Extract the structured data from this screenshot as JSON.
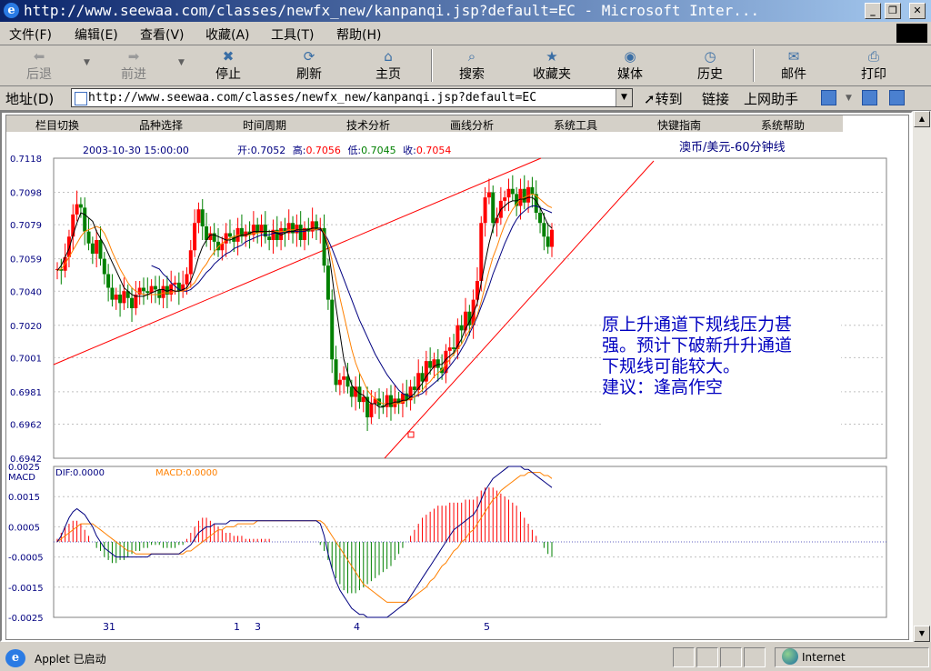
{
  "window": {
    "title": "http://www.seewaa.com/classes/newfx_new/kanpanqi.jsp?default=EC - Microsoft Inter..."
  },
  "menu": [
    "文件(F)",
    "编辑(E)",
    "查看(V)",
    "收藏(A)",
    "工具(T)",
    "帮助(H)"
  ],
  "toolbar": {
    "back": "后退",
    "forward": "前进",
    "stop": "停止",
    "refresh": "刷新",
    "home": "主页",
    "search": "搜索",
    "favorites": "收藏夹",
    "media": "媒体",
    "history": "历史",
    "mail": "邮件",
    "print": "打印"
  },
  "address": {
    "label": "地址(D)",
    "url": "http://www.seewaa.com/classes/newfx_new/kanpanqi.jsp?default=EC",
    "go": "转到",
    "links": "链接",
    "helper": "上网助手"
  },
  "applet_nav": [
    "栏目切换",
    "品种选择",
    "时间周期",
    "技术分析",
    "画线分析",
    "系统工具",
    "快键指南",
    "系统帮助"
  ],
  "chart": {
    "title": "澳币/美元-60分钟线",
    "datetime": "2003-10-30 15:00:00",
    "ohlc": {
      "open_label": "开:",
      "open": "0.7052",
      "high_label": "高:",
      "high": "0.7056",
      "low_label": "低:",
      "low": "0.7045",
      "close_label": "收:",
      "close": "0.7054"
    },
    "annotation": [
      "原上升通道下规线压力甚",
      "强。预计下破新升升通道",
      "下规线可能较大。",
      "建议：逢高作空"
    ],
    "macd_label": "MACD",
    "dif_label": "DIF:0.0000",
    "macd_value_label": "MACD:0.0000",
    "date_labels": [
      "31",
      "1",
      "3",
      "4",
      "5"
    ],
    "colors": {
      "up": "#ff0000",
      "down": "#008000",
      "ma_short": "#000000",
      "ma_mid": "#ff8000",
      "ma_long": "#000080",
      "trend": "#ff0000",
      "annotation": "#0000c0"
    }
  },
  "chart_data": [
    {
      "type": "candlestick",
      "title": "澳币/美元-60分钟线",
      "ylim": [
        0.6942,
        0.7118
      ],
      "yticks": [
        "0.7118",
        "0.7098",
        "0.7079",
        "0.7059",
        "0.7040",
        "0.7020",
        "0.7001",
        "0.6981",
        "0.6962",
        "0.6942"
      ],
      "closes": [
        0.7053,
        0.7052,
        0.706,
        0.7072,
        0.7085,
        0.7091,
        0.7089,
        0.7075,
        0.7068,
        0.7062,
        0.707,
        0.7059,
        0.705,
        0.7042,
        0.7035,
        0.7038,
        0.7033,
        0.704,
        0.7036,
        0.703,
        0.7038,
        0.7042,
        0.704,
        0.7039,
        0.7043,
        0.7041,
        0.7036,
        0.7043,
        0.7038,
        0.7044,
        0.7045,
        0.704,
        0.7044,
        0.705,
        0.7064,
        0.708,
        0.7088,
        0.7078,
        0.707,
        0.7074,
        0.7069,
        0.7064,
        0.7068,
        0.7074,
        0.7072,
        0.7069,
        0.7077,
        0.7072,
        0.7075,
        0.7073,
        0.7079,
        0.7074,
        0.7079,
        0.7072,
        0.707,
        0.7076,
        0.707,
        0.7077,
        0.7074,
        0.708,
        0.7074,
        0.7079,
        0.707,
        0.7077,
        0.7075,
        0.7081,
        0.7076,
        0.7077,
        0.7055,
        0.7035,
        0.7,
        0.6985,
        0.6988,
        0.699,
        0.6984,
        0.6978,
        0.6984,
        0.6975,
        0.6978,
        0.6966,
        0.6974,
        0.6977,
        0.6973,
        0.6972,
        0.6979,
        0.6972,
        0.6977,
        0.6974,
        0.698,
        0.6976,
        0.6984,
        0.6982,
        0.6992,
        0.6987,
        0.6999,
        0.6995,
        0.7,
        0.6995,
        0.6992,
        0.7005,
        0.7007,
        0.7006,
        0.702,
        0.7017,
        0.7028,
        0.702,
        0.7035,
        0.7046,
        0.708,
        0.7095,
        0.7098,
        0.708,
        0.7083,
        0.7093,
        0.7095,
        0.71,
        0.7097,
        0.709,
        0.71,
        0.7092,
        0.7101,
        0.7097,
        0.7086,
        0.708,
        0.7072,
        0.7066,
        0.7076
      ],
      "ma_short": [
        0.7052,
        0.7055,
        0.706,
        0.7065,
        0.7073,
        0.708,
        0.7086,
        0.7085,
        0.7083,
        0.7081,
        0.7075,
        0.7071,
        0.7067,
        0.7062,
        0.7057,
        0.7052,
        0.7047,
        0.7042,
        0.704,
        0.7038,
        0.7037,
        0.7037,
        0.7037,
        0.7038,
        0.7039,
        0.704,
        0.7041,
        0.7041,
        0.704,
        0.7041,
        0.704,
        0.704,
        0.7041,
        0.7042,
        0.7046,
        0.7052,
        0.706,
        0.7066,
        0.707,
        0.7073,
        0.7073,
        0.7072,
        0.7071,
        0.707,
        0.707,
        0.7071,
        0.7072,
        0.7073,
        0.7073,
        0.7074,
        0.7075,
        0.7075,
        0.7075,
        0.7075,
        0.7075,
        0.7075,
        0.7074,
        0.7073,
        0.7074,
        0.7075,
        0.7075,
        0.7076,
        0.7076,
        0.7076,
        0.7076,
        0.7077,
        0.7077,
        0.7077,
        0.7073,
        0.7065,
        0.7049,
        0.7031,
        0.7015,
        0.7,
        0.6992,
        0.6985,
        0.6982,
        0.698,
        0.6979,
        0.6976,
        0.6974,
        0.6974,
        0.6972,
        0.6972,
        0.6974,
        0.6974,
        0.6975,
        0.6975,
        0.6976,
        0.6976,
        0.6978,
        0.698,
        0.6983,
        0.6986,
        0.699,
        0.6993,
        0.6996,
        0.6997,
        0.6997,
        0.7,
        0.7002,
        0.7004,
        0.7008,
        0.7012,
        0.7018,
        0.7022,
        0.7027,
        0.7033,
        0.7045,
        0.7057,
        0.7068,
        0.7077,
        0.7083,
        0.7088,
        0.709,
        0.7092,
        0.7093,
        0.7093,
        0.7094,
        0.7094,
        0.7095,
        0.7095,
        0.7093,
        0.7089,
        0.7084,
        0.7079,
        0.7077
      ],
      "ma_mid": [
        0.7052,
        0.7053,
        0.7056,
        0.706,
        0.7064,
        0.7068,
        0.7072,
        0.7075,
        0.7076,
        0.7077,
        0.7078,
        0.7077,
        0.7074,
        0.7069,
        0.7063,
        0.7058,
        0.7053,
        0.7049,
        0.7045,
        0.7042,
        0.704,
        0.7039,
        0.7038,
        0.7038,
        0.7038,
        0.7038,
        0.7038,
        0.7039,
        0.7039,
        0.7039,
        0.704,
        0.704,
        0.704,
        0.7041,
        0.7043,
        0.7045,
        0.7049,
        0.7053,
        0.7056,
        0.706,
        0.7063,
        0.7066,
        0.7068,
        0.707,
        0.7071,
        0.7072,
        0.7073,
        0.7073,
        0.7073,
        0.7073,
        0.7074,
        0.7074,
        0.7075,
        0.7075,
        0.7075,
        0.7075,
        0.7075,
        0.7075,
        0.7075,
        0.7076,
        0.7076,
        0.7076,
        0.7076,
        0.7076,
        0.7076,
        0.7076,
        0.7076,
        0.7077,
        0.7074,
        0.7068,
        0.7058,
        0.7047,
        0.7036,
        0.7026,
        0.7016,
        0.7006,
        0.6998,
        0.6992,
        0.6987,
        0.6982,
        0.6979,
        0.6977,
        0.6975,
        0.6974,
        0.6974,
        0.6974,
        0.6974,
        0.6974,
        0.6975,
        0.6976,
        0.6977,
        0.6978,
        0.698,
        0.6982,
        0.6985,
        0.6987,
        0.699,
        0.6992,
        0.6994,
        0.6997,
        0.7,
        0.7003,
        0.7006,
        0.7009,
        0.7013,
        0.7017,
        0.7021,
        0.7026,
        0.7034,
        0.7043,
        0.7052,
        0.706,
        0.7066,
        0.7073,
        0.7079,
        0.7084,
        0.7088,
        0.7091,
        0.7094,
        0.7095,
        0.7096,
        0.7097,
        0.7096,
        0.7094,
        0.7092,
        0.709,
        0.7089
      ],
      "ma_long": [
        null,
        null,
        null,
        null,
        null,
        null,
        null,
        null,
        null,
        null,
        null,
        null,
        null,
        null,
        null,
        null,
        null,
        null,
        null,
        null,
        null,
        null,
        null,
        null,
        0.7055,
        0.7054,
        0.7053,
        0.705,
        0.7048,
        0.7045,
        0.7043,
        0.7041,
        0.704,
        0.704,
        0.7041,
        0.7043,
        0.7045,
        0.7048,
        0.7051,
        0.7053,
        0.7056,
        0.7058,
        0.706,
        0.7062,
        0.7063,
        0.7065,
        0.7066,
        0.7067,
        0.7069,
        0.707,
        0.7071,
        0.7072,
        0.7073,
        0.7073,
        0.7073,
        0.7074,
        0.7074,
        0.7074,
        0.7075,
        0.7075,
        0.7075,
        0.7075,
        0.7075,
        0.7075,
        0.7076,
        0.7076,
        0.7076,
        0.7076,
        0.7074,
        0.707,
        0.7065,
        0.7059,
        0.7053,
        0.7047,
        0.7041,
        0.7035,
        0.7029,
        0.7023,
        0.7018,
        0.7013,
        0.7008,
        0.7003,
        0.6999,
        0.6995,
        0.6991,
        0.6988,
        0.6985,
        0.6982,
        0.698,
        0.6979,
        0.6978,
        0.6978,
        0.6979,
        0.698,
        0.6982,
        0.6984,
        0.6986,
        0.6988,
        0.699,
        0.6993,
        0.6996,
        0.6999,
        0.7002,
        0.7006,
        0.701,
        0.7015,
        0.702,
        0.7025,
        0.7031,
        0.7037,
        0.7043,
        0.705,
        0.7056,
        0.7062,
        0.7068,
        0.7073,
        0.7078,
        0.7082,
        0.7085,
        0.7087,
        0.7089,
        0.709,
        0.709,
        0.7089,
        0.7088,
        0.7087,
        0.7086
      ]
    },
    {
      "type": "macd",
      "ylim": [
        -0.0025,
        0.0025
      ],
      "yticks": [
        "0.0025",
        "0.0015",
        "0.0005",
        "-0.0005",
        "-0.0015",
        "-0.0025"
      ],
      "histogram": [
        0.0001,
        0.0003,
        0.0005,
        0.0006,
        0.0007,
        0.0007,
        0.0006,
        0.0004,
        0.0002,
        0.0,
        -0.0002,
        -0.0003,
        -0.0005,
        -0.0006,
        -0.0007,
        -0.0007,
        -0.0006,
        -0.0006,
        -0.0005,
        -0.0004,
        -0.0003,
        -0.0003,
        -0.0002,
        -0.0002,
        -0.0001,
        -0.0001,
        -0.0001,
        -0.0002,
        -0.0002,
        -0.0002,
        -0.0002,
        -0.0001,
        -0.0001,
        0.0001,
        0.0003,
        0.0005,
        0.0007,
        0.0008,
        0.0008,
        0.0007,
        0.0006,
        0.0005,
        0.0004,
        0.0003,
        0.0003,
        0.0002,
        0.0002,
        0.0002,
        0.0001,
        0.0001,
        0.0001,
        0.0001,
        0.0001,
        0.0001,
        0.0001,
        0.0,
        0.0,
        0.0,
        0.0,
        0.0,
        0.0,
        0.0,
        0.0,
        0.0,
        0.0,
        0.0,
        0.0,
        -0.0001,
        -0.0003,
        -0.0006,
        -0.0009,
        -0.0012,
        -0.0014,
        -0.0016,
        -0.0017,
        -0.0017,
        -0.0017,
        -0.0016,
        -0.0015,
        -0.0014,
        -0.0013,
        -0.0012,
        -0.0011,
        -0.001,
        -0.0009,
        -0.0008,
        -0.0006,
        -0.0004,
        -0.0002,
        0.0,
        0.0002,
        0.0004,
        0.0006,
        0.0008,
        0.0009,
        0.001,
        0.0011,
        0.0012,
        0.0012,
        0.0012,
        0.0013,
        0.0013,
        0.0013,
        0.0013,
        0.0014,
        0.0014,
        0.0014,
        0.0015,
        0.0017,
        0.0018,
        0.0018,
        0.0018,
        0.0017,
        0.0016,
        0.0015,
        0.0014,
        0.0013,
        0.0012,
        0.001,
        0.0008,
        0.0006,
        0.0004,
        0.0002,
        0.0,
        -0.0002,
        -0.0004,
        -0.0005
      ],
      "dif": [
        0.0,
        0.0002,
        0.0005,
        0.0008,
        0.001,
        0.0011,
        0.001,
        0.0009,
        0.0007,
        0.0005,
        0.0002,
        0.0,
        -0.0002,
        -0.0003,
        -0.0004,
        -0.0005,
        -0.0005,
        -0.0005,
        -0.0005,
        -0.0005,
        -0.0005,
        -0.0005,
        -0.0005,
        -0.0005,
        -0.0004,
        -0.0004,
        -0.0004,
        -0.0004,
        -0.0004,
        -0.0004,
        -0.0004,
        -0.0004,
        -0.0003,
        -0.0002,
        -0.0001,
        0.0001,
        0.0003,
        0.0004,
        0.0005,
        0.0005,
        0.0006,
        0.0006,
        0.0006,
        0.0006,
        0.0007,
        0.0007,
        0.0007,
        0.0007,
        0.0007,
        0.0007,
        0.0007,
        0.0007,
        0.0007,
        0.0007,
        0.0007,
        0.0007,
        0.0007,
        0.0007,
        0.0007,
        0.0007,
        0.0007,
        0.0007,
        0.0007,
        0.0007,
        0.0007,
        0.0007,
        0.0007,
        0.0006,
        0.0002,
        -0.0004,
        -0.0009,
        -0.0013,
        -0.0016,
        -0.0018,
        -0.002,
        -0.0022,
        -0.0023,
        -0.0024,
        -0.0024,
        -0.0025,
        -0.0025,
        -0.0025,
        -0.0025,
        -0.0025,
        -0.0025,
        -0.0024,
        -0.0023,
        -0.0022,
        -0.0021,
        -0.002,
        -0.0018,
        -0.0016,
        -0.0014,
        -0.0012,
        -0.001,
        -0.0008,
        -0.0006,
        -0.0004,
        -0.0002,
        0.0,
        0.0002,
        0.0004,
        0.0005,
        0.0006,
        0.0007,
        0.0008,
        0.0009,
        0.0011,
        0.0014,
        0.0017,
        0.0019,
        0.0021,
        0.0022,
        0.0023,
        0.0024,
        0.0025,
        0.0025,
        0.0025,
        0.0025,
        0.0024,
        0.0024,
        0.0023,
        0.0022,
        0.0021,
        0.002,
        0.0019,
        0.0018
      ],
      "dea": [
        0.0,
        0.0001,
        0.0002,
        0.0003,
        0.0004,
        0.0005,
        0.0006,
        0.0006,
        0.0006,
        0.0006,
        0.0005,
        0.0004,
        0.0003,
        0.0002,
        0.0001,
        0.0,
        -0.0001,
        -0.0002,
        -0.0003,
        -0.0003,
        -0.0004,
        -0.0004,
        -0.0004,
        -0.0004,
        -0.0004,
        -0.0004,
        -0.0004,
        -0.0004,
        -0.0004,
        -0.0004,
        -0.0004,
        -0.0004,
        -0.0004,
        -0.0003,
        -0.0003,
        -0.0002,
        -0.0001,
        0.0,
        0.0001,
        0.0002,
        0.0003,
        0.0004,
        0.0004,
        0.0005,
        0.0005,
        0.0005,
        0.0006,
        0.0006,
        0.0006,
        0.0006,
        0.0006,
        0.0007,
        0.0007,
        0.0007,
        0.0007,
        0.0007,
        0.0007,
        0.0007,
        0.0007,
        0.0007,
        0.0007,
        0.0007,
        0.0007,
        0.0007,
        0.0007,
        0.0007,
        0.0007,
        0.0007,
        0.0006,
        0.0004,
        0.0002,
        0.0,
        -0.0002,
        -0.0004,
        -0.0006,
        -0.0008,
        -0.001,
        -0.0012,
        -0.0014,
        -0.0015,
        -0.0016,
        -0.0017,
        -0.0018,
        -0.0019,
        -0.002,
        -0.002,
        -0.002,
        -0.002,
        -0.002,
        -0.002,
        -0.0019,
        -0.0018,
        -0.0017,
        -0.0016,
        -0.0015,
        -0.0013,
        -0.0012,
        -0.001,
        -0.0008,
        -0.0007,
        -0.0005,
        -0.0003,
        -0.0002,
        0.0,
        0.0001,
        0.0003,
        0.0004,
        0.0006,
        0.0008,
        0.001,
        0.0012,
        0.0014,
        0.0015,
        0.0017,
        0.0018,
        0.0019,
        0.002,
        0.0021,
        0.0022,
        0.0022,
        0.0023,
        0.0023,
        0.0023,
        0.0023,
        0.0022,
        0.0022,
        0.0021
      ]
    }
  ],
  "status": {
    "message": "Applet 已启动",
    "zone": "Internet"
  }
}
